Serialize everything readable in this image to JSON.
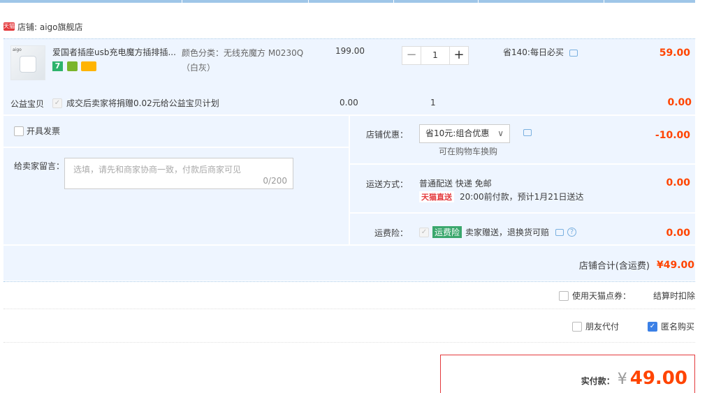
{
  "shop": {
    "badge": "天猫",
    "label": "店铺: aigo旗舰店"
  },
  "item": {
    "name": "爱国者插座usb充电魔方插排插...",
    "sku_line1": "颜色分类：无线充魔方 M0230Q",
    "sku_line2": "（白灰）",
    "unit_price": "199.00",
    "quantity": "1",
    "qty_minus": "−",
    "qty_plus": "+",
    "promo": "省140:每日必买",
    "subtotal": "59.00",
    "service_icons": [
      "7-day-return-icon",
      "guarantee-icon",
      "card-icon"
    ],
    "service_7": "7"
  },
  "charity": {
    "label": "公益宝贝",
    "desc": "成交后卖家将捐赠0.02元给公益宝贝计划",
    "price": "0.00",
    "quantity": "1",
    "amount": "0.00"
  },
  "invoice": {
    "label": "开具发票"
  },
  "shop_discount": {
    "label": "店铺优惠：",
    "selected": "省10元:组合优惠",
    "hint": "可在购物车换购",
    "amount": "-10.00"
  },
  "message": {
    "label": "给卖家留言：",
    "placeholder": "选填，请先和商家协商一致，付款后商家可见",
    "counter": "0/200"
  },
  "shipping": {
    "label": "运送方式：",
    "method": "普通配送 快递 免邮",
    "badge": "天猫直送",
    "eta": "20:00前付款，预计1月21日送达",
    "amount": "0.00"
  },
  "insurance": {
    "label": "运费险：",
    "tag": "运费险",
    "desc": "卖家赠送，退换货可赔",
    "amount": "0.00"
  },
  "shop_total": {
    "label": "店铺合计(含运费)",
    "amount": "¥49.00"
  },
  "points": {
    "label": "使用天猫点券：",
    "note": "结算时扣除"
  },
  "friend_pay": {
    "label": "朋友代付"
  },
  "anonymous": {
    "label": "匿名购买"
  },
  "pay": {
    "label": "实付款：",
    "currency": "¥",
    "amount": "49.00"
  },
  "colors": {
    "accent": "#f40",
    "border_blue": "#9fc6e8",
    "panel": "#eef5ff",
    "checkbox_on": "#3b80e6"
  }
}
